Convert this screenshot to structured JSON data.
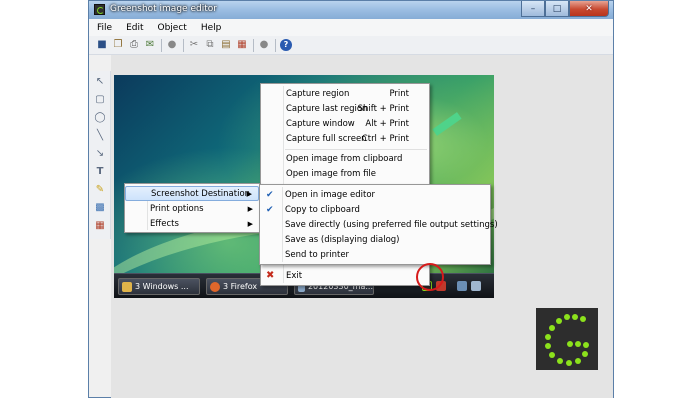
{
  "window": {
    "title": "Greenshot image editor"
  },
  "menubar": {
    "items": [
      "File",
      "Edit",
      "Object",
      "Help"
    ]
  },
  "toolbar": {
    "icons": [
      "save-icon",
      "copy-icon",
      "print-icon",
      "email-icon",
      "clear-icon",
      "cut-icon",
      "copy-icon",
      "paste-icon",
      "crop-icon",
      "settings-icon",
      "help-icon"
    ]
  },
  "tools": {
    "icons": [
      "cursor-icon",
      "rectangle-icon",
      "ellipse-icon",
      "line-icon",
      "arrow-icon",
      "text-icon",
      "highlight-icon",
      "obfuscate-icon",
      "crop-icon"
    ]
  },
  "taskbar": {
    "tasks": [
      "3 Windows ...",
      "3 Firefox",
      "20120330_ma..."
    ]
  },
  "menu_main": {
    "items": [
      {
        "label": "Capture region",
        "shortcut": "Print"
      },
      {
        "label": "Capture last region",
        "shortcut": "Shift + Print"
      },
      {
        "label": "Capture window",
        "shortcut": "Alt + Print"
      },
      {
        "label": "Capture full screen",
        "shortcut": "Ctrl + Print"
      },
      {
        "label": "Open image from clipboard"
      },
      {
        "label": "Open image from file"
      },
      {
        "label": "Exit"
      }
    ]
  },
  "menu_settings": {
    "items": [
      "Screenshot Destination",
      "Print options",
      "Effects"
    ]
  },
  "menu_destination": {
    "items": [
      {
        "label": "Open in image editor",
        "checked": true
      },
      {
        "label": "Copy to clipboard",
        "checked": true
      },
      {
        "label": "Save directly (using preferred file output settings)",
        "checked": false
      },
      {
        "label": "Save as (displaying dialog)",
        "checked": false
      },
      {
        "label": "Send to printer",
        "checked": false
      }
    ]
  },
  "colors": {
    "accent": "#84acdd",
    "logo_green": "#8ce21c",
    "highlight_red": "#d61b1b"
  }
}
